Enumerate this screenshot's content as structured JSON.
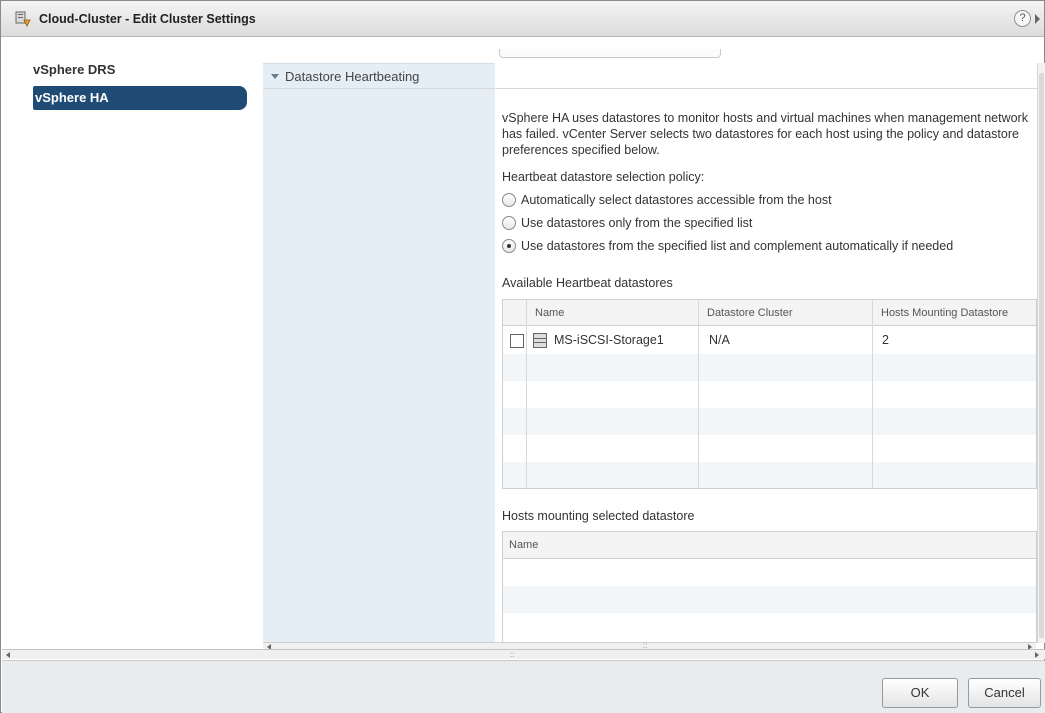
{
  "dialog": {
    "title": "Cloud-Cluster - Edit Cluster Settings",
    "help_glyph": "?"
  },
  "nav": {
    "items": [
      {
        "label": "vSphere DRS",
        "selected": false
      },
      {
        "label": "vSphere HA",
        "selected": true
      }
    ]
  },
  "section": {
    "label": "Datastore Heartbeating"
  },
  "content": {
    "description": "vSphere HA uses datastores to monitor hosts and virtual machines when management network has failed. vCenter Server selects two datastores for each host using the policy and datastore preferences specified below.",
    "policy_label": "Heartbeat datastore selection policy:",
    "policy_options": [
      {
        "label": "Automatically select datastores accessible from the host",
        "selected": false
      },
      {
        "label": "Use datastores only from the specified list",
        "selected": false
      },
      {
        "label": "Use datastores from the specified list and complement automatically if needed",
        "selected": true
      }
    ],
    "available_label": "Available Heartbeat datastores",
    "datastores_table": {
      "columns": [
        "Name",
        "Datastore Cluster",
        "Hosts Mounting Datastore"
      ],
      "rows": [
        {
          "name": "MS-iSCSI-Storage1",
          "cluster": "N/A",
          "hosts": "2",
          "checked": false
        }
      ]
    },
    "hosts_label": "Hosts mounting selected datastore",
    "hosts_table": {
      "columns": [
        "Name"
      ]
    }
  },
  "footer": {
    "ok_label": "OK",
    "cancel_label": "Cancel"
  },
  "colors": {
    "nav_selected": "#1f4b74",
    "section_panel": "#e6eef5"
  }
}
